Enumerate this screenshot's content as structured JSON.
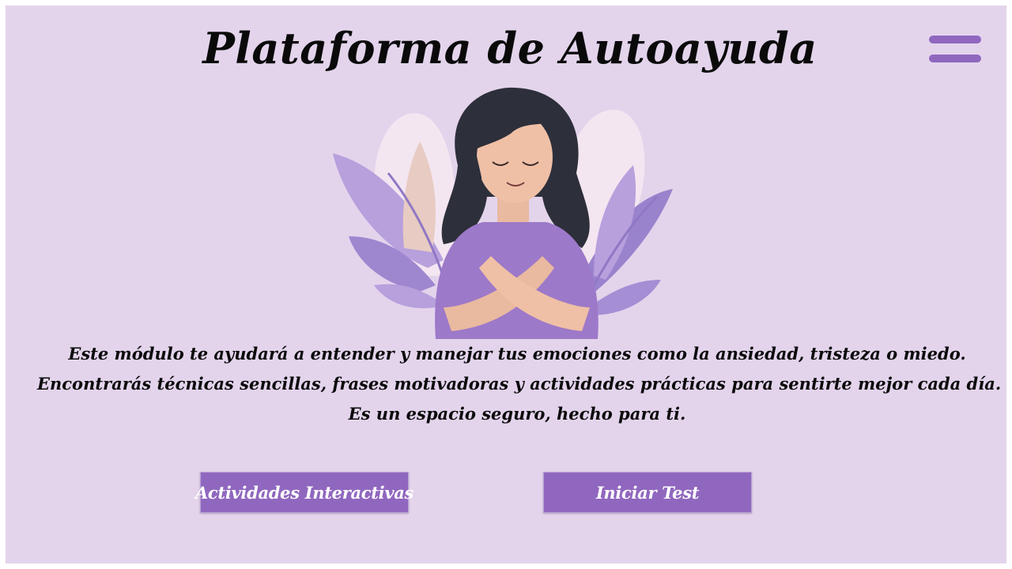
{
  "header": {
    "title": "Plataforma de Autoayuda",
    "menu_icon": "hamburger-menu-icon"
  },
  "hero": {
    "illustration": "woman-hugging-self-illustration"
  },
  "intro": {
    "lines": [
      "Este módulo te ayudará a entender y manejar tus emociones como la ansiedad, tristeza o miedo.",
      "Encontrarás técnicas sencillas, frases motivadoras y actividades prácticas para sentirte mejor cada día.",
      "Es un espacio seguro, hecho para ti."
    ]
  },
  "actions": {
    "activities_label": "Actividades Interactivas",
    "test_label": "Iniciar Test"
  },
  "colors": {
    "background": "#e3d4ec",
    "accent": "#9067bf",
    "text": "#0a0a0a",
    "button_text": "#ffffff"
  }
}
